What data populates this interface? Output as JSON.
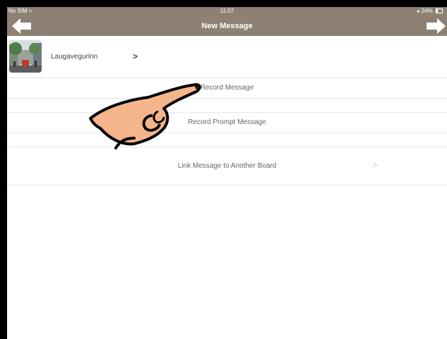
{
  "status_bar": {
    "carrier": "No SIM",
    "time": "11:07",
    "battery": "24%"
  },
  "navbar": {
    "title": "New Message",
    "back_icon": "back-arrow-icon",
    "forward_icon": "forward-arrow-icon"
  },
  "board": {
    "name": "Laugavegurinn",
    "chevron": ">"
  },
  "options": [
    {
      "label": "Record Message"
    },
    {
      "label": "Record Prompt Message"
    },
    {
      "label": "Link Message to Another Board",
      "chevron": ">"
    }
  ],
  "colors": {
    "navbar": "#8e8174",
    "hand": "#f5b58b",
    "separator": "#e6e6e6"
  }
}
